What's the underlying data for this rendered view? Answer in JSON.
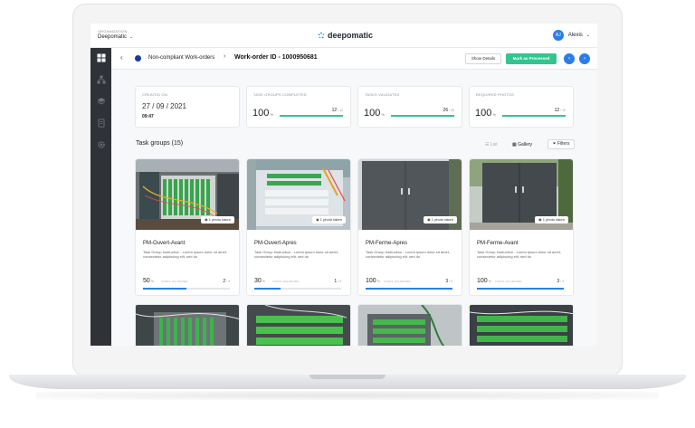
{
  "topbar": {
    "org_label": "ORGANIZATION",
    "org_name": "Deepomatic",
    "brand": "deepomatic",
    "user_initials": "AJ",
    "user_name": "Alexis"
  },
  "breadcrumb": {
    "parent": "Non-compliant Work-orders",
    "current": "Work-order ID - 1000950681"
  },
  "actions": {
    "show_details": "Show Details",
    "mark_processed": "Mark as Processed"
  },
  "colors": {
    "accent_green": "#33c48f",
    "accent_blue": "#2b7de9",
    "sidebar": "#2f3237"
  },
  "stats": {
    "created": {
      "label": "CREATED ON",
      "date": "27 / 09 / 2021",
      "time": "09:47"
    },
    "completed": {
      "label": "TASK GROUPS COMPLETED",
      "value": "100",
      "unit": "%",
      "count": "12",
      "total": "/ 12",
      "progress": 1.0
    },
    "validated": {
      "label": "TASKS VALIDATED",
      "value": "100",
      "unit": "%",
      "count": "26",
      "total": "/ 26",
      "progress": 1.0
    },
    "photos": {
      "label": "REQUIRED PHOTOS",
      "value": "100",
      "unit": "%",
      "count": "12",
      "total": "/ 12",
      "progress": 1.0
    }
  },
  "task_groups": {
    "title": "Task groups (15)",
    "view_list": "List",
    "view_gallery": "Gallery",
    "filters": "Filters",
    "cards": [
      {
        "name": "PM-Ouvert-Avant",
        "badge": "1 photo taken",
        "desc": "Task Group Instruction - Lorem ipsum dolor sit amet, consectetur adipiscing elit, sed do",
        "pct": "50",
        "unit": "%",
        "sub": "TASKS VALIDATED",
        "count": "2",
        "total": "/ 4",
        "progress": 0.5
      },
      {
        "name": "PM-Ouvert-Apres",
        "badge": "1 photo taken",
        "desc": "Task Group Instruction - Lorem ipsum dolor sit amet, consectetur adipiscing elit, sed do",
        "pct": "30",
        "unit": "%",
        "sub": "TASKS VALIDATED",
        "count": "1",
        "total": "/ 3",
        "progress": 0.3
      },
      {
        "name": "PM-Ferme-Apres",
        "badge": "1 photo taken",
        "desc": "Task Group Instruction - Lorem ipsum dolor sit amet, consectetur adipiscing elit, sed do",
        "pct": "100",
        "unit": "%",
        "sub": "TASKS VALIDATED",
        "count": "3",
        "total": "/ 3",
        "progress": 1.0
      },
      {
        "name": "PM-Ferme-Avant",
        "badge": "1 photo taken",
        "desc": "Task Group Instruction - Lorem ipsum dolor sit amet, consectetur adipiscing elit, sed do",
        "pct": "100",
        "unit": "%",
        "sub": "TASKS VALIDATED",
        "count": "3",
        "total": "/ 3",
        "progress": 1.0
      }
    ]
  }
}
